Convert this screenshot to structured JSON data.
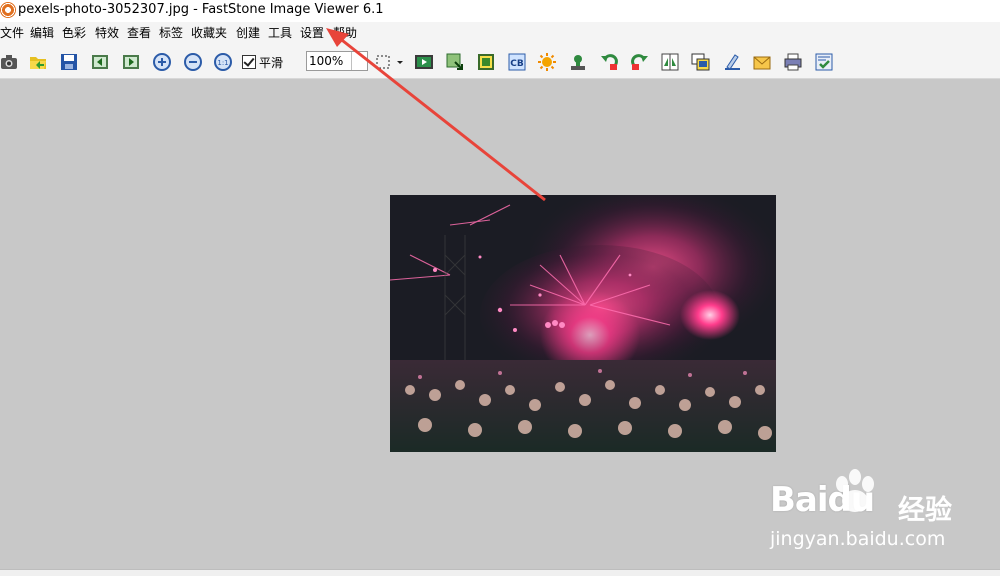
{
  "window": {
    "title": "pexels-photo-3052307.jpg  -  FastStone Image Viewer 6.1"
  },
  "menu": [
    {
      "label": "文件"
    },
    {
      "label": "编辑"
    },
    {
      "label": "色彩"
    },
    {
      "label": "特效"
    },
    {
      "label": "查看"
    },
    {
      "label": "标签"
    },
    {
      "label": "收藏夹"
    },
    {
      "label": "创建"
    },
    {
      "label": "工具"
    },
    {
      "label": "设置"
    },
    {
      "label": "帮助"
    }
  ],
  "toolbar": {
    "smooth_label": "平滑",
    "smooth_checked": true,
    "zoom_value": "100%",
    "icons": [
      "camera-icon",
      "open-folder-icon",
      "save-icon",
      "previous-image-icon",
      "next-image-icon",
      "zoom-in-icon",
      "zoom-out-icon",
      "actual-size-icon",
      "selection-icon",
      "slideshow-icon",
      "resize-icon",
      "crop-icon",
      "color-adjust-icon",
      "brightness-icon",
      "stamp-icon",
      "rotate-left-icon",
      "rotate-right-icon",
      "flip-icon",
      "compare-icon",
      "draw-icon",
      "email-icon",
      "print-icon",
      "settings-check-icon"
    ]
  },
  "annotation": {
    "arrow_color": "#e8443a",
    "points_to": "设置"
  },
  "watermark": {
    "brand": "Baidu",
    "cn": "经验",
    "url": "jingyan.baidu.com"
  }
}
